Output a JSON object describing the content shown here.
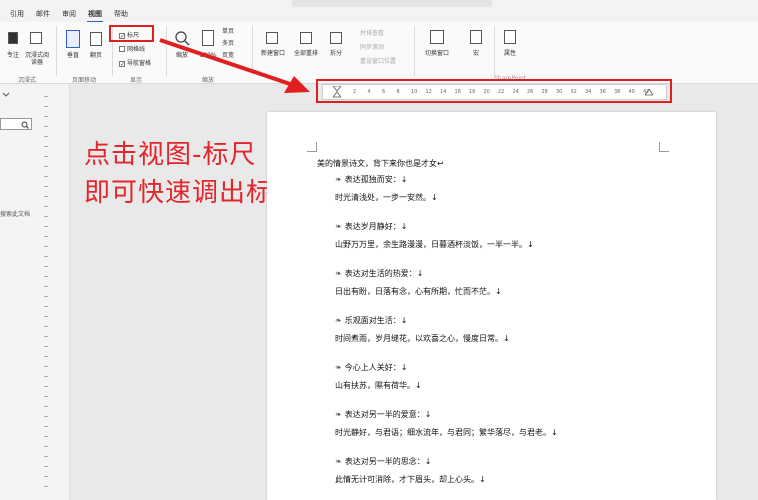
{
  "menu": {
    "tabs": [
      "引用",
      "邮件",
      "审阅",
      "视图",
      "帮助"
    ],
    "active": "视图"
  },
  "ribbon": {
    "views_group": {
      "label": "沉浸式",
      "buttons": [
        "专注",
        "沉浸式阅读器"
      ]
    },
    "page_move_group": {
      "label": "页面移动",
      "buttons": [
        "垂直",
        "翻页"
      ]
    },
    "show_group": {
      "label": "显示",
      "ruler": "标尺",
      "gridlines": "网格线",
      "nav_pane": "导航窗格"
    },
    "zoom_group": {
      "label": "缩放",
      "buttons": [
        "缩放",
        "100%"
      ],
      "page_options": [
        "单页",
        "多页",
        "页宽"
      ]
    },
    "window_group": {
      "label": "窗口",
      "buttons": [
        "新建窗口",
        "全部重排",
        "拆分"
      ],
      "faded": [
        "并排查看",
        "同步滚动",
        "重设窗口位置"
      ]
    },
    "switch_window": "切换窗口",
    "macro": "宏",
    "sharepoint": {
      "label": "SharePoint",
      "button": "属性"
    }
  },
  "ruler": {
    "ticks": [
      "2",
      "4",
      "6",
      "8",
      "10",
      "12",
      "14",
      "16",
      "18",
      "20",
      "22",
      "24",
      "26",
      "28",
      "30",
      "32",
      "34",
      "36",
      "38",
      "40",
      "42"
    ]
  },
  "left_pane": {
    "nav_text": "搜索此文档"
  },
  "annotation": {
    "line1": "点击视图-标尺",
    "line2": "即可快速调出标尺"
  },
  "document": {
    "intro": "美的情景诗文，背下来你也是才女↩",
    "sections": [
      {
        "head": "表达孤独而安：↓",
        "body": "时光清浅处，一步一安然。↓"
      },
      {
        "head": "表达岁月静好：↓",
        "body": "山野万万里，余生路漫漫，日暮酒杯淡饭，一半一半。↓"
      },
      {
        "head": "表达对生活的热爱：↓",
        "body": "日出有盼，日落有念，心有所期，忙而不茫。↓"
      },
      {
        "head": "乐观面对生活：↓",
        "body": "时间煮雨，岁月缝花，以欢喜之心，慢度日常。↓"
      },
      {
        "head": "今心上人关好：↓",
        "body": "山有扶苏，隰有荷华。↓"
      },
      {
        "head": "表达对另一半的爱意：↓",
        "body": "时光静好，与君语；细水流年，与君同；繁华落尽，与君老。↓"
      },
      {
        "head": "表达对另一半的思念：↓",
        "body": "此情无计可消除，才下眉头，却上心头。↓"
      }
    ]
  },
  "colors": {
    "accent": "#2f5fd1",
    "annotation_red": "#e3262b"
  }
}
